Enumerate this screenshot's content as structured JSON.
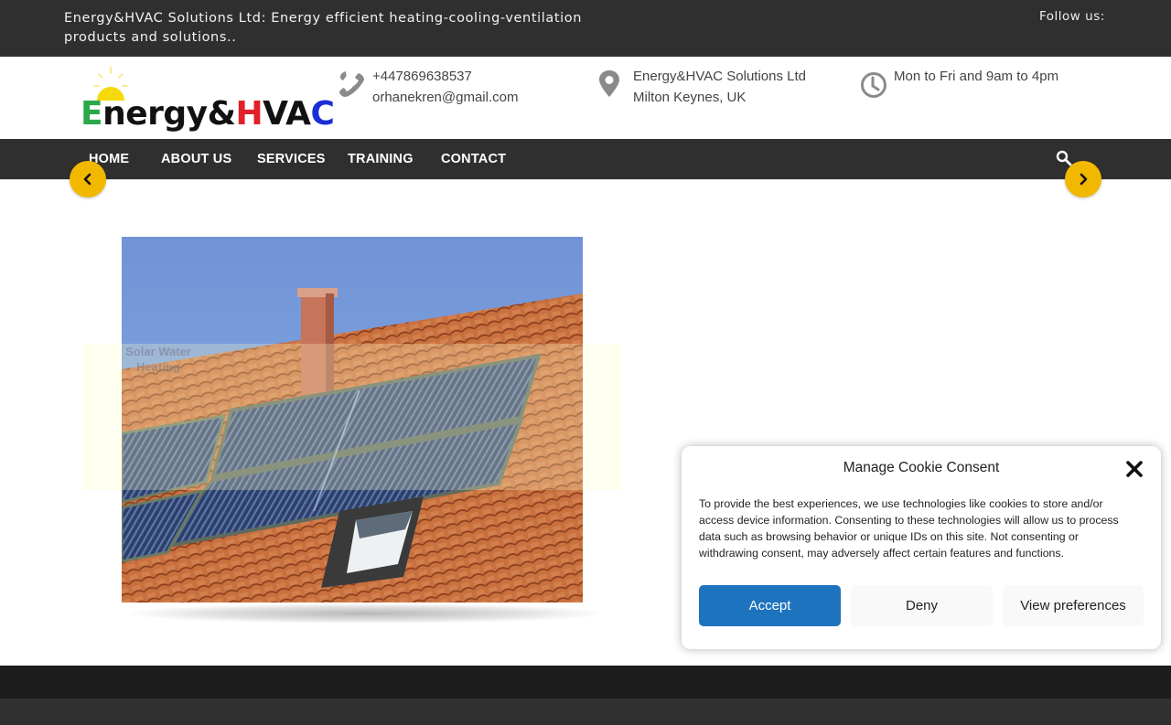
{
  "topbar": {
    "tagline": "Energy&HVAC Solutions Ltd: Energy efficient heating-cooling-ventilation products and solutions..",
    "follow_label": "Follow us:"
  },
  "header": {
    "logo": {
      "part_e": "E",
      "part_nergy": "nergy&",
      "part_h": "H",
      "part_va": "VA",
      "part_c": "C",
      "colors": {
        "e": "#2aa84a",
        "h": "#e0202a",
        "c": "#1a2fd6",
        "sun": "#f5d90a"
      }
    },
    "contact": {
      "phone": "+447869638537",
      "email": "orhanekren@gmail.com",
      "icon": "phone-icon"
    },
    "address": {
      "line1": "Energy&HVAC Solutions Ltd",
      "line2": "Milton Keynes, UK",
      "icon": "map-marker-icon"
    },
    "hours": {
      "text": "Mon to Fri and 9am to 4pm",
      "icon": "clock-icon"
    }
  },
  "nav": {
    "items": [
      {
        "label": "HOME"
      },
      {
        "label": "ABOUT US"
      },
      {
        "label": "SERVICES"
      },
      {
        "label": "TRAINING"
      },
      {
        "label": "CONTACT"
      }
    ],
    "search_icon": "search-icon"
  },
  "slider": {
    "prev_icon": "chevron-left-icon",
    "next_icon": "chevron-right-icon",
    "image_alt": "Solar water heating collectors on a tiled roof",
    "faded_caption": "Solar Water Heating",
    "accent_color": "#f2b800"
  },
  "cookie": {
    "title": "Manage Cookie Consent",
    "body": "To provide the best experiences, we use technologies like cookies to store and/or access device information. Consenting to these technologies will allow us to process data such as browsing behavior or unique IDs on this site. Not consenting or withdrawing consent, may adversely affect certain features and functions.",
    "accept_label": "Accept",
    "deny_label": "Deny",
    "preferences_label": "View preferences",
    "accept_color": "#1e73be"
  }
}
